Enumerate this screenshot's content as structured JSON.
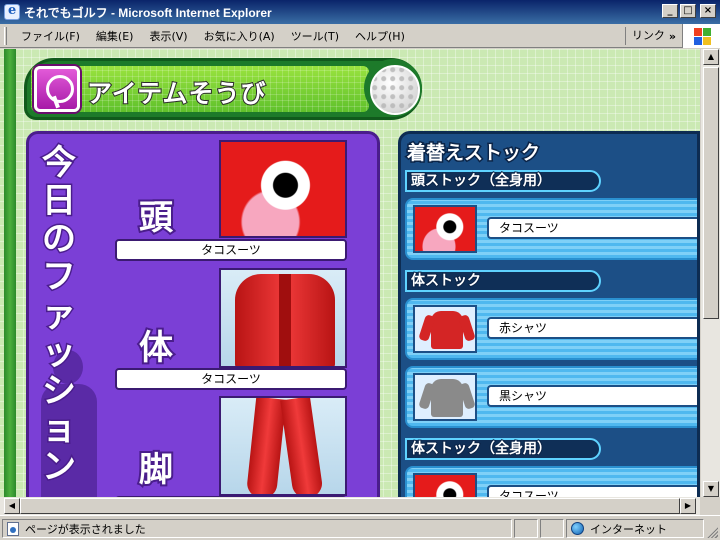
{
  "window": {
    "title": "それでもゴルフ - Microsoft Internet Explorer",
    "min_label": "_",
    "max_label": "□",
    "close_label": "×"
  },
  "menubar": {
    "items": [
      "ファイル(F)",
      "編集(E)",
      "表示(V)",
      "お気に入り(A)",
      "ツール(T)",
      "ヘルプ(H)"
    ],
    "links_label": "リンク",
    "links_chevron": "»"
  },
  "page": {
    "banner_title": "アイテムそうび",
    "fashion": {
      "title": "今日のファッション",
      "slots": [
        {
          "label": "頭",
          "item": "タコスーツ"
        },
        {
          "label": "体",
          "item": "タコスーツ"
        },
        {
          "label": "脚",
          "item": ""
        }
      ]
    },
    "stock": {
      "title": "着替えストック",
      "sections": [
        {
          "header": "頭ストック（全身用）",
          "items": [
            {
              "name": "タコスーツ",
              "thumb": "octopus-head"
            }
          ]
        },
        {
          "header": "体ストック",
          "items": [
            {
              "name": "赤シャツ",
              "thumb": "red-shirt"
            },
            {
              "name": "黒シャツ",
              "thumb": "black-shirt"
            }
          ]
        },
        {
          "header": "体ストック（全身用）",
          "items": [
            {
              "name": "タコスーツ",
              "thumb": "octopus-suit"
            }
          ]
        }
      ]
    }
  },
  "statusbar": {
    "text": "ページが表示されました",
    "zone": "インターネット"
  },
  "colors": {
    "titlebar": "#0a246a",
    "fashion_panel": "#7b3fd6",
    "stock_panel": "#1c4f86",
    "banner_green": "#1d7a2a"
  }
}
